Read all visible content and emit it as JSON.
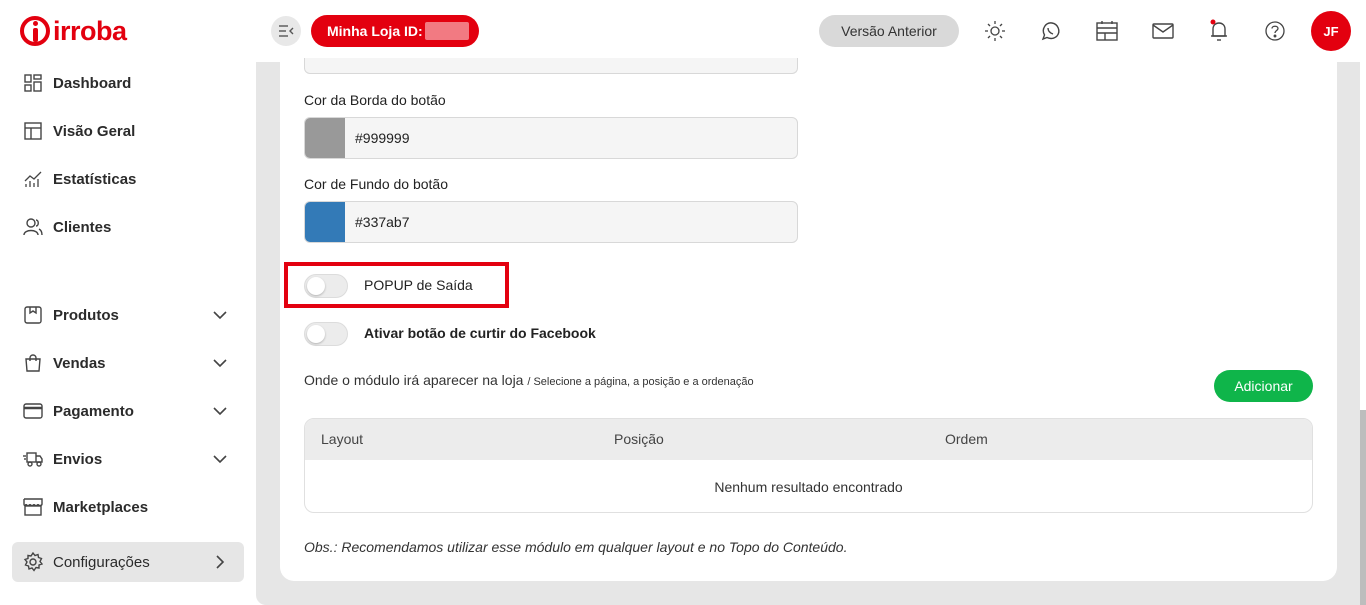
{
  "brand": {
    "name": "irroba",
    "color": "#e3000f"
  },
  "sidebar": {
    "items": [
      {
        "label": "Dashboard",
        "icon": "dashboard-icon"
      },
      {
        "label": "Visão Geral",
        "icon": "overview-icon"
      },
      {
        "label": "Estatísticas",
        "icon": "chart-icon"
      },
      {
        "label": "Clientes",
        "icon": "users-icon"
      },
      {
        "label": "Produtos",
        "icon": "box-icon"
      },
      {
        "label": "Vendas",
        "icon": "bag-icon"
      },
      {
        "label": "Pagamento",
        "icon": "card-icon"
      },
      {
        "label": "Envios",
        "icon": "truck-icon"
      },
      {
        "label": "Marketplaces",
        "icon": "store-icon"
      },
      {
        "label": "Configurações",
        "icon": "gear-icon"
      }
    ]
  },
  "topbar": {
    "store_label": "Minha Loja ID:",
    "previous_version": "Versão Anterior",
    "avatar_initials": "JF"
  },
  "form": {
    "border_color_label": "Cor da Borda do botão",
    "border_color_value": "#999999",
    "bg_color_label": "Cor de Fundo do botão",
    "bg_color_value": "#337ab7",
    "popup_exit_label": "POPUP de Saída",
    "facebook_like_label": "Ativar botão de curtir do Facebook"
  },
  "placement": {
    "title": "Onde o módulo irá aparecer na loja",
    "subtitle": "/ Selecione a página, a posição e a ordenação",
    "add_button": "Adicionar",
    "columns": [
      "Layout",
      "Posição",
      "Ordem"
    ],
    "empty_message": "Nenhum resultado encontrado",
    "note": "Obs.: Recomendamos utilizar esse módulo em qualquer layout e no Topo do Conteúdo."
  }
}
